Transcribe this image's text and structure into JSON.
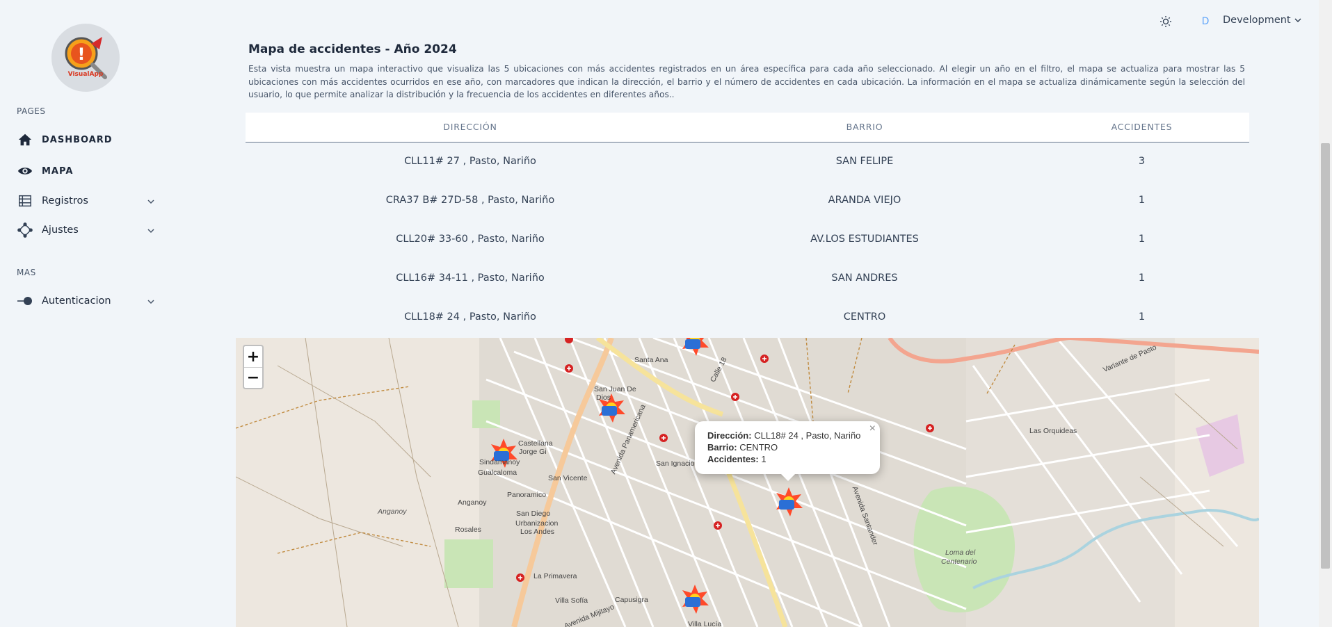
{
  "sidebar": {
    "logo_text": "VisualApp",
    "pages_label": "PAGES",
    "mas_label": "MAS",
    "items": [
      {
        "label": "DASHBOARD",
        "icon": "home-icon"
      },
      {
        "label": "MAPA",
        "icon": "eye-icon"
      },
      {
        "label": "Registros",
        "icon": "table-icon"
      },
      {
        "label": "Ajustes",
        "icon": "nodes-icon"
      },
      {
        "label": "Autenticacion",
        "icon": "toggle-icon"
      }
    ]
  },
  "topbar": {
    "avatar_letter": "D",
    "environment": "Development",
    "theme_icon": "sun-icon"
  },
  "main": {
    "title": "Mapa de accidentes - Año 2024",
    "description": "Esta vista muestra un mapa interactivo que visualiza las 5 ubicaciones con más accidentes registrados en un área específica para cada año seleccionado. Al elegir un año en el filtro, el mapa se actualiza para mostrar las 5 ubicaciones con más accidentes ocurridos en ese año, con marcadores que indican la dirección, el barrio y el número de accidentes en cada ubicación. La información en el mapa se actualiza dinámicamente según la selección del usuario, lo que permite analizar la distribución y la frecuencia de los accidentes en diferentes años..",
    "table": {
      "headers": [
        "DIRECCIÓN",
        "BARRIO",
        "ACCIDENTES"
      ],
      "rows": [
        [
          "CLL11# 27 , Pasto, Nariño",
          "SAN FELIPE",
          "3"
        ],
        [
          "CRA37 B# 27D-58 , Pasto, Nariño",
          "ARANDA VIEJO",
          "1"
        ],
        [
          "CLL20# 33-60 , Pasto, Nariño",
          "AV.LOS ESTUDIANTES",
          "1"
        ],
        [
          "CLL16# 34-11 , Pasto, Nariño",
          "SAN ANDRES",
          "1"
        ],
        [
          "CLL18# 24 , Pasto, Nariño",
          "CENTRO",
          "1"
        ]
      ]
    }
  },
  "map": {
    "zoom_in": "+",
    "zoom_out": "−",
    "popup": {
      "direccion_label": "Dirección:",
      "direccion": "CLL18# 24 , Pasto, Nariño",
      "barrio_label": "Barrio:",
      "barrio": "CENTRO",
      "accidentes_label": "Accidentes:",
      "accidentes": "1",
      "close": "×"
    },
    "labels": {
      "santa_ana": "Santa Ana",
      "san_juan": "San Juan De",
      "dios": "Dios",
      "castellana": "Castellana",
      "jorge": "Jorge Gi",
      "sindamanoy": "Sindamanoy",
      "san_vicente": "San Vicente",
      "gualcaloma": "Gualcaloma",
      "panoramico": "Panoramico",
      "anganoy1": "Anganoy",
      "anganoy2": "Anganoy",
      "rosales": "Rosales",
      "san_diego": "San Diego",
      "urbanizacion": "Urbanizacion",
      "los_andes": "Los Andes",
      "la_primavera": "La Primavera",
      "villa_sofia": "Villa Sofía",
      "capusigra": "Capusigra",
      "villa_lucia": "Villa Lucía",
      "san_ignacio": "San Ignacio",
      "las_orquideas": "Las Orquideas",
      "loma": "Loma del",
      "centenario": "Centenario",
      "variante": "Variante de Pasto",
      "av_panamericana": "Avenida Panamericana",
      "av_santander": "Avenida Santander",
      "av_mijitayo": "Avenida Mijitayo",
      "calle18": "Calle 18"
    }
  }
}
